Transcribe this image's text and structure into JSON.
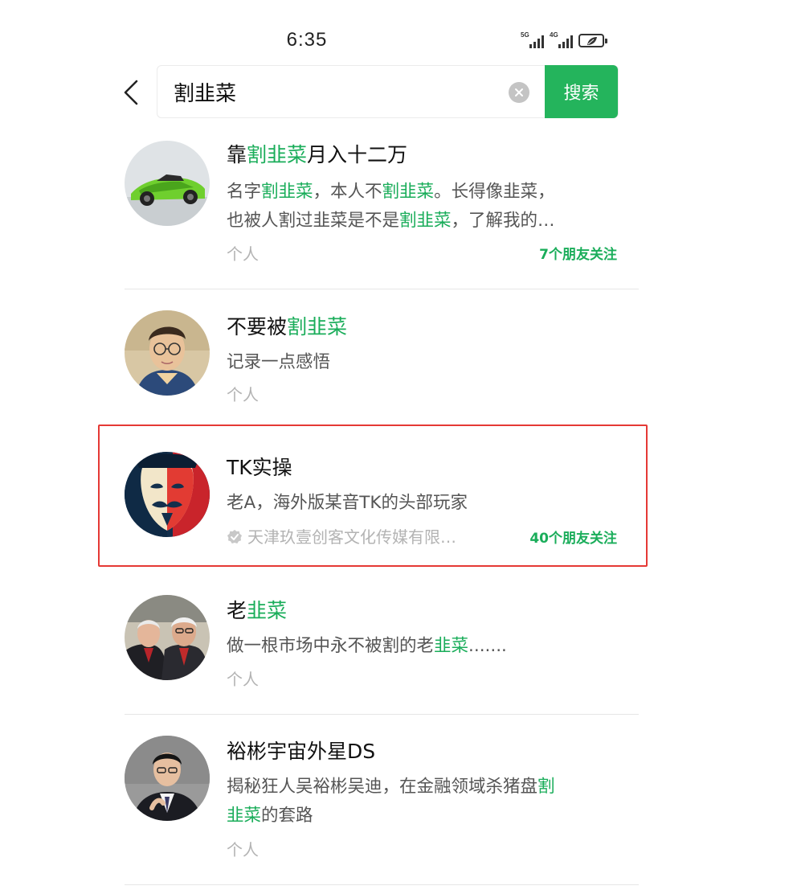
{
  "status": {
    "time": "6:35",
    "signal1_tag": "5G",
    "signal2_tag": "4G",
    "battery_icon": "battery-leaf-icon"
  },
  "search": {
    "query": "割韭菜",
    "button_label": "搜索",
    "back_icon": "chevron-left-icon",
    "clear_icon": "clear-circle-icon"
  },
  "colors": {
    "accent": "#1aad5a",
    "search_button": "#24b45c",
    "highlight_frame": "#e53935"
  },
  "results": [
    {
      "title_parts": [
        "靠",
        "割韭菜",
        "月入十二万"
      ],
      "desc_line1_parts": [
        "名字",
        "割韭菜",
        "，本人不",
        "割韭菜",
        "。长得像韭菜，"
      ],
      "desc_line2_parts": [
        "也被人割过韭菜是不是",
        "割韭菜",
        "，了解我的…"
      ],
      "type": "个人",
      "follow": "7个朋友关注",
      "avatar": "green-sports-car"
    },
    {
      "title_parts": [
        "不要被",
        "割韭菜"
      ],
      "desc": "记录一点感悟",
      "type": "个人",
      "avatar": "young-man-glasses"
    },
    {
      "title": "TK实操",
      "desc": "老A，海外版某音TK的头部玩家",
      "verified_icon": "verified-badge-icon",
      "type": "天津玖壹创客文化传媒有限…",
      "follow": "40个朋友关注",
      "avatar": "guy-fawkes-mask"
    },
    {
      "title_parts": [
        "老",
        "韭菜"
      ],
      "desc_parts": [
        "做一根市场中永不被割的老",
        "韭菜",
        "......."
      ],
      "type": "个人",
      "avatar": "two-elderly-men"
    },
    {
      "title": "裕彬宇宙外星DS",
      "desc_line1_parts": [
        "揭秘狂人吴裕彬吴迪，在金融领域杀猪盘",
        "割"
      ],
      "desc_line2_parts": [
        "韭菜",
        "的套路"
      ],
      "type": "个人",
      "avatar": "man-in-suit"
    }
  ]
}
